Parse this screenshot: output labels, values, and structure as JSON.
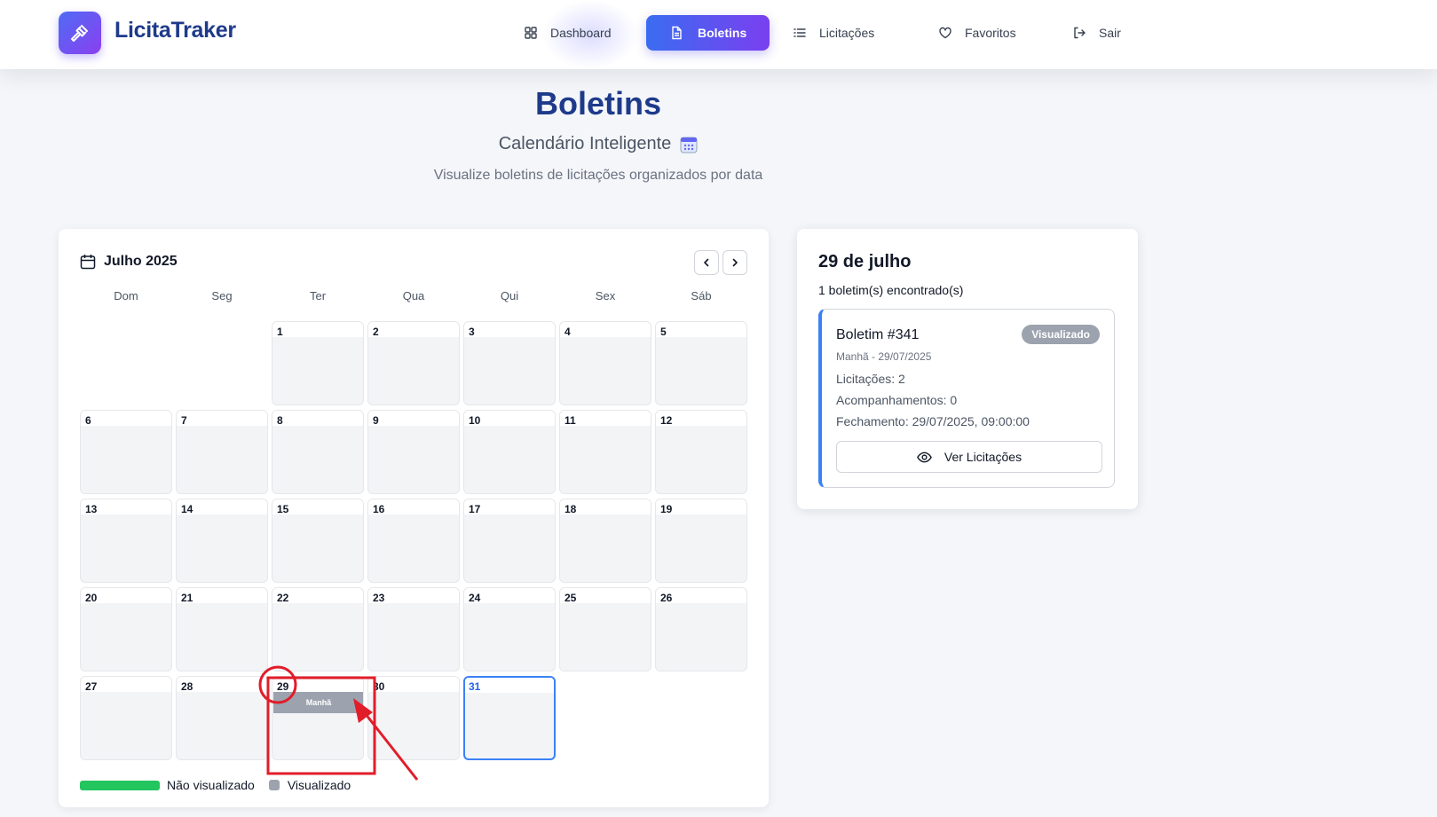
{
  "brand": {
    "name": "LicitaTraker",
    "logo_icon": "gavel-icon",
    "accent_from": "#4f6bf5",
    "accent_to": "#8b3ff0"
  },
  "nav": {
    "items": [
      {
        "label": "Dashboard",
        "icon": "grid-icon",
        "active": false
      },
      {
        "label": "Boletins",
        "icon": "document-icon",
        "active": true
      },
      {
        "label": "Licitações",
        "icon": "list-icon",
        "active": false
      },
      {
        "label": "Favoritos",
        "icon": "heart-icon",
        "active": false
      },
      {
        "label": "Sair",
        "icon": "logout-icon",
        "active": false
      }
    ]
  },
  "header": {
    "title": "Boletins",
    "subtitle": "Calendário Inteligente",
    "subtitle_icon": "calendar-emoji-icon",
    "description": "Visualize boletins de licitações organizados por data"
  },
  "calendar": {
    "month_label": "Julho 2025",
    "weekdays": [
      "Dom",
      "Seg",
      "Ter",
      "Qua",
      "Qui",
      "Sex",
      "Sáb"
    ],
    "days_in_month": 31,
    "first_weekday": 2,
    "today": 31,
    "events": [
      {
        "day": 29,
        "label": "Manhã",
        "status": "visualizado"
      }
    ],
    "legend": {
      "not_viewed": "Não visualizado",
      "viewed": "Visualizado",
      "not_viewed_color": "#22c55e",
      "viewed_color": "#9ca3af"
    }
  },
  "details": {
    "date_title": "29 de julho",
    "count_text": "1 boletim(s) encontrado(s)",
    "bulletin": {
      "title": "Boletim #341",
      "badge": "Visualizado",
      "meta": "Manhã - 29/07/2025",
      "licitacoes": "Licitações: 2",
      "acompanhamentos": "Acompanhamentos: 0",
      "fechamento": "Fechamento: 29/07/2025, 09:00:00",
      "button_label": "Ver Licitações"
    }
  }
}
